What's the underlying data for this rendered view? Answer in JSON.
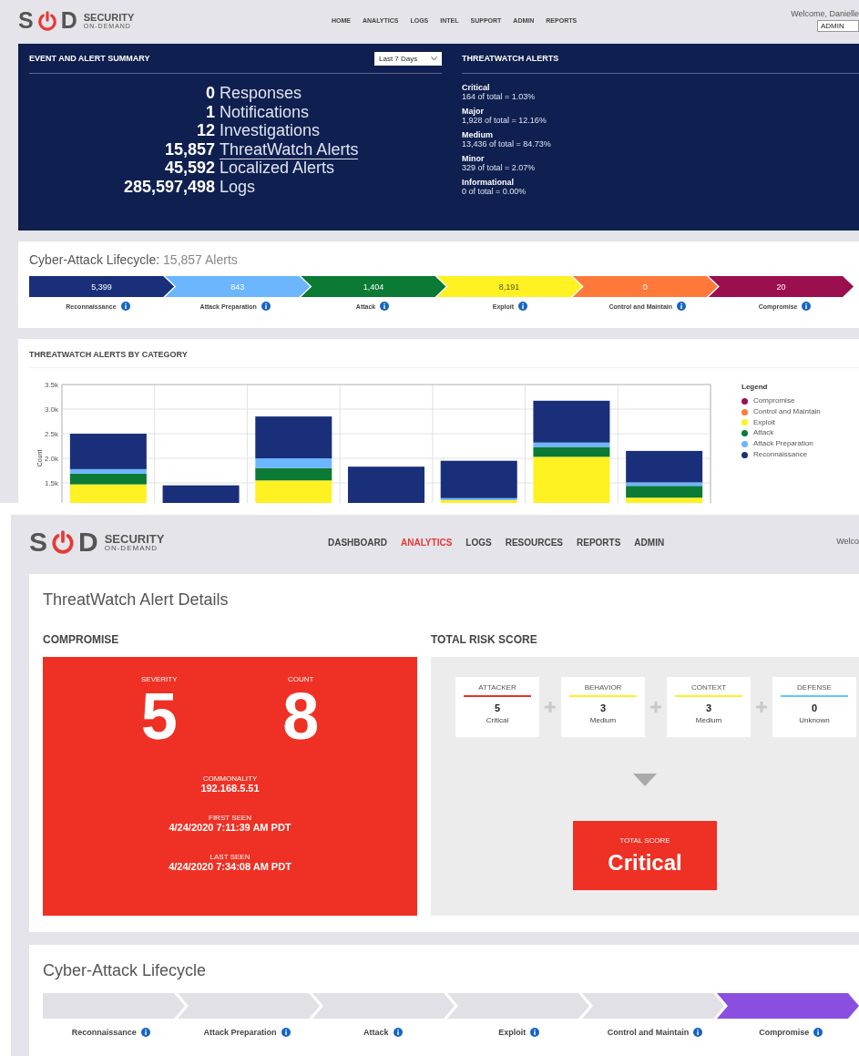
{
  "dashboard": {
    "header": {
      "logo": {
        "letters": [
          "S",
          "D"
        ],
        "brand": "SECURITY",
        "tagline": "ON-DEMAND"
      },
      "nav": [
        {
          "label": "HOME",
          "selected": false
        },
        {
          "label": "ANALYTICS",
          "selected": false
        },
        {
          "label": "LOGS",
          "selected": false
        },
        {
          "label": "INTEL",
          "selected": false
        },
        {
          "label": "SUPPORT",
          "selected": false
        },
        {
          "label": "ADMIN",
          "selected": false
        },
        {
          "label": "REPORTS",
          "selected": false
        }
      ],
      "welcome": "Welcome, Danielle",
      "role_select": "ADMIN"
    },
    "event_summary": {
      "title": "EVENT AND ALERT SUMMARY",
      "range_select": "Last 7 Days",
      "stats": [
        {
          "count": "0",
          "label": "Responses",
          "link": false
        },
        {
          "count": "1",
          "label": "Notifications",
          "link": false
        },
        {
          "count": "12",
          "label": "Investigations",
          "link": false
        },
        {
          "count": "15,857",
          "label": "ThreatWatch Alerts",
          "link": true
        },
        {
          "count": "45,592",
          "label": "Localized Alerts",
          "link": false
        },
        {
          "count": "285,597,498",
          "label": "Logs",
          "link": false
        }
      ]
    },
    "threatwatch_alerts": {
      "title": "THREATWATCH ALERTS",
      "levels": [
        {
          "name": "Critical",
          "detail": "164 of total = 1.03%"
        },
        {
          "name": "Major",
          "detail": "1,928 of total = 12.16%"
        },
        {
          "name": "Medium",
          "detail": "13,436 of total = 84.73%"
        },
        {
          "name": "Minor",
          "detail": "329 of total = 2.07%"
        },
        {
          "name": "Informational",
          "detail": "0 of total = 0.00%"
        }
      ]
    },
    "lifecycle": {
      "title": "Cyber-Attack Lifecycle:",
      "total": "15,857 Alerts",
      "stages": [
        {
          "label": "Reconnaissance",
          "value": "5,399",
          "color": "#1a2f7a"
        },
        {
          "label": "Attack Preparation",
          "value": "843",
          "color": "#6cb5ff"
        },
        {
          "label": "Attack",
          "value": "1,404",
          "color": "#0a7a35"
        },
        {
          "label": "Exploit",
          "value": "8,191",
          "color": "#fff122"
        },
        {
          "label": "Control and Maintain",
          "value": "0",
          "color": "#ff7a3a"
        },
        {
          "label": "Compromise",
          "value": "20",
          "color": "#9b0f4f"
        }
      ]
    },
    "category_chart": {
      "title": "THREATWATCH ALERTS BY CATEGORY",
      "legend_title": "Legend",
      "chart_data": {
        "type": "bar",
        "stacked": true,
        "grid": true,
        "ylabel": "Count",
        "ylim": [
          0,
          3500
        ],
        "yticks": [
          {
            "value": 1500,
            "label": "1.5k"
          },
          {
            "value": 2000,
            "label": "2.0k"
          },
          {
            "value": 2500,
            "label": "2.5k"
          },
          {
            "value": 3000,
            "label": "3.0k"
          },
          {
            "value": 3500,
            "label": "3.5k"
          }
        ],
        "series": [
          {
            "name": "Compromise",
            "color": "#9b0f4f",
            "values": [
              0,
              0,
              0,
              0,
              0,
              0,
              0
            ]
          },
          {
            "name": "Control and Maintain",
            "color": "#ff7a3a",
            "values": [
              0,
              0,
              0,
              0,
              0,
              0,
              0
            ]
          },
          {
            "name": "Exploit",
            "color": "#fff122",
            "values": [
              1470,
              0,
              1550,
              0,
              1150,
              2030,
              1200
            ]
          },
          {
            "name": "Attack",
            "color": "#0a7a35",
            "values": [
              220,
              0,
              250,
              0,
              0,
              200,
              240
            ]
          },
          {
            "name": "Attack Preparation",
            "color": "#6cb5ff",
            "values": [
              90,
              0,
              200,
              0,
              40,
              90,
              70
            ]
          },
          {
            "name": "Reconnaissance",
            "color": "#1a2f7a",
            "values": [
              720,
              1450,
              850,
              1830,
              760,
              850,
              640
            ]
          }
        ]
      }
    }
  },
  "alert_details": {
    "header": {
      "logo": {
        "letters": [
          "S",
          "D"
        ],
        "brand": "SECURITY",
        "tagline": "ON-DEMAND"
      },
      "nav": [
        {
          "label": "DASHBOARD",
          "selected": false
        },
        {
          "label": "ANALYTICS",
          "selected": true
        },
        {
          "label": "LOGS",
          "selected": false
        },
        {
          "label": "RESOURCES",
          "selected": false
        },
        {
          "label": "REPORTS",
          "selected": false
        },
        {
          "label": "ADMIN",
          "selected": false
        }
      ],
      "welcome": "Welco"
    },
    "title": "ThreatWatch Alert Details",
    "compromise": {
      "title": "COMPROMISE",
      "severity_label": "SEVERITY",
      "severity": "5",
      "count_label": "COUNT",
      "count": "8",
      "fields": [
        {
          "label": "COMMONALITY",
          "value": "192.168.5.51"
        },
        {
          "label": "FIRST SEEN",
          "value": "4/24/2020 7:11:39 AM PDT"
        },
        {
          "label": "LAST SEEN",
          "value": "4/24/2020 7:34:08 AM PDT"
        }
      ]
    },
    "risk_score": {
      "title": "TOTAL RISK SCORE",
      "factors": [
        {
          "name": "ATTACKER",
          "score": "5",
          "rating": "Critical",
          "color": "#ee3124"
        },
        {
          "name": "BEHAVIOR",
          "score": "3",
          "rating": "Medium",
          "color": "#fff122"
        },
        {
          "name": "CONTEXT",
          "score": "3",
          "rating": "Medium",
          "color": "#fff122"
        },
        {
          "name": "DEFENSE",
          "score": "0",
          "rating": "Unknown",
          "color": "#5cc8ff"
        }
      ],
      "total_label": "TOTAL SCORE",
      "total": "Critical"
    },
    "lifecycle": {
      "title": "Cyber-Attack Lifecycle",
      "stages": [
        {
          "label": "Reconnaissance",
          "selected": false
        },
        {
          "label": "Attack Preparation",
          "selected": false
        },
        {
          "label": "Attack",
          "selected": false
        },
        {
          "label": "Exploit",
          "selected": false
        },
        {
          "label": "Control and Maintain",
          "selected": false
        },
        {
          "label": "Compromise",
          "selected": true
        }
      ]
    }
  }
}
